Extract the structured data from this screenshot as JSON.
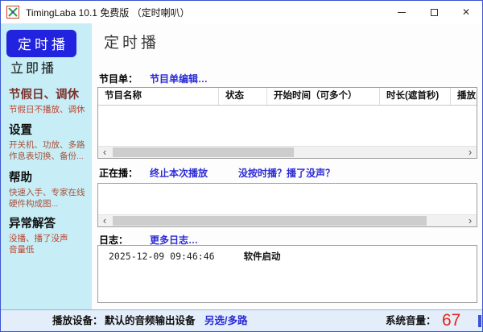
{
  "window": {
    "title": "TimingLaba 10.1 免费版 （定时喇叭）"
  },
  "sidebar": {
    "items": [
      {
        "label": "定时播",
        "selected": true
      },
      {
        "label": "立即播"
      },
      {
        "label": "节假日、调休",
        "subtitle": "节假日不播放、调休"
      },
      {
        "label": "设置",
        "subtitle": "开关机、功放、多路\n作息表切换、备份..."
      },
      {
        "label": "帮助",
        "subtitle": "快速入手、专家在线\n硬件构成图..."
      },
      {
        "label": "异常解答",
        "subtitle": "没播、播了没声\n音量低"
      }
    ]
  },
  "main": {
    "page_title": "定时播",
    "playlist": {
      "label": "节目单：",
      "edit_link": "节目单编辑…",
      "columns": [
        "节目名称",
        "状态",
        "开始时间（可多个）",
        "时长(遮首秒)",
        "播放内容"
      ],
      "rows": []
    },
    "now_playing": {
      "label": "正在播：",
      "stop_link": "终止本次播放",
      "help_link": "没按时播？播了没声？"
    },
    "log": {
      "label": "日志：",
      "more_link": "更多日志…",
      "entries": [
        {
          "time": "2025-12-09 09:46:46",
          "message": "软件启动"
        }
      ]
    }
  },
  "statusbar": {
    "device_label": "播放设备：",
    "device_value": "默认的音频输出设备",
    "device_link": "另选/多路",
    "volume_label": "系统音量：",
    "volume_value": "67"
  },
  "icons": {
    "scroll_left": "‹",
    "scroll_right": "›",
    "close": "✕"
  },
  "colors": {
    "sidebar_bg": "#c7eef6",
    "selected_item_bg": "#2123de",
    "link": "#2b2bd6",
    "holiday_text": "#7a332d",
    "subtitle_text": "#a8503a",
    "volume_value": "#e3251b",
    "statusbar_bg": "#e4eefa",
    "window_border": "#3c55d0"
  }
}
